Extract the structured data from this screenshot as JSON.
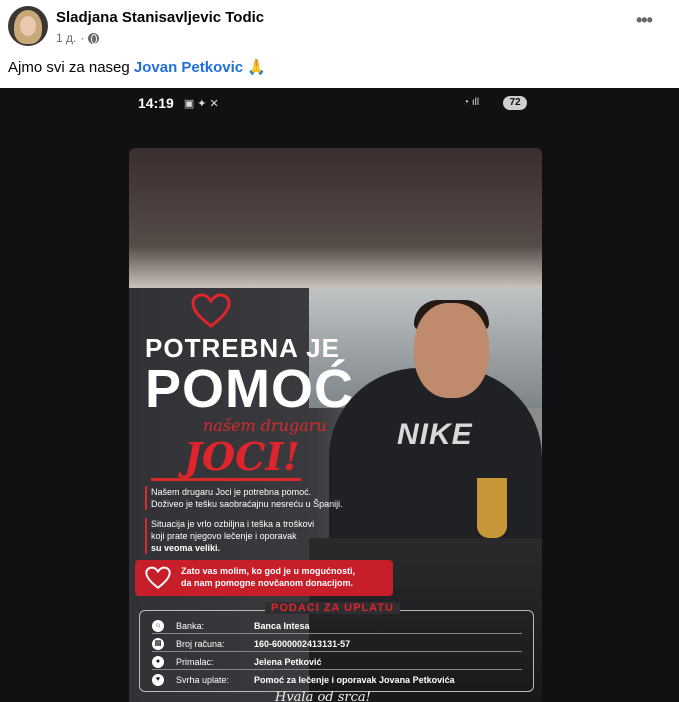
{
  "post": {
    "author": "Sladjana Stanisavljevic Todic",
    "time": "1 д.",
    "more_label": "•••",
    "text_prefix": "Ajmo svi za naseg ",
    "mention": "Jovan Petkovic",
    "emoji": "🙏"
  },
  "phone_status": {
    "time": "14:19",
    "battery": "72"
  },
  "poster": {
    "headline_line1": "POTREBNA JE",
    "headline_line2": "POMOĆ",
    "headline_line3": "našem drugaru",
    "headline_line4": "JOCI!",
    "shirt_text": "NIKE",
    "paragraph1_line1": "Našem drugaru Joci je potrebna pomoć.",
    "paragraph1_line2": "Doživeo je tešku saobraćajnu nesreću u Španiji.",
    "paragraph2_line1": "Situacija je vrlo ozbiljna i teška a troškovi",
    "paragraph2_line2": "koji prate njegovo lečenje i oporavak",
    "paragraph2_line3": "su veoma veliki.",
    "appeal_line1": "Zato vas molim, ko god je u mogućnosti,",
    "appeal_line2": "da nam pomogne novčanom donacijom.",
    "payment_title": "PODACI ZA UPLATU",
    "payment_rows": [
      {
        "label": "Banka:",
        "value": "Banca Intesa"
      },
      {
        "label": "Broj računa:",
        "value": "160-6000002413131-57"
      },
      {
        "label": "Primalac:",
        "value": "Jelena Petković"
      },
      {
        "label": "Svrha uplate:",
        "value": "Pomoć za lečenje i oporavak Jovana Petkovića"
      }
    ],
    "thanks": "Hvala od srca!"
  },
  "colors": {
    "accent_red": "#e0242c",
    "mention_blue": "#216fdb"
  }
}
